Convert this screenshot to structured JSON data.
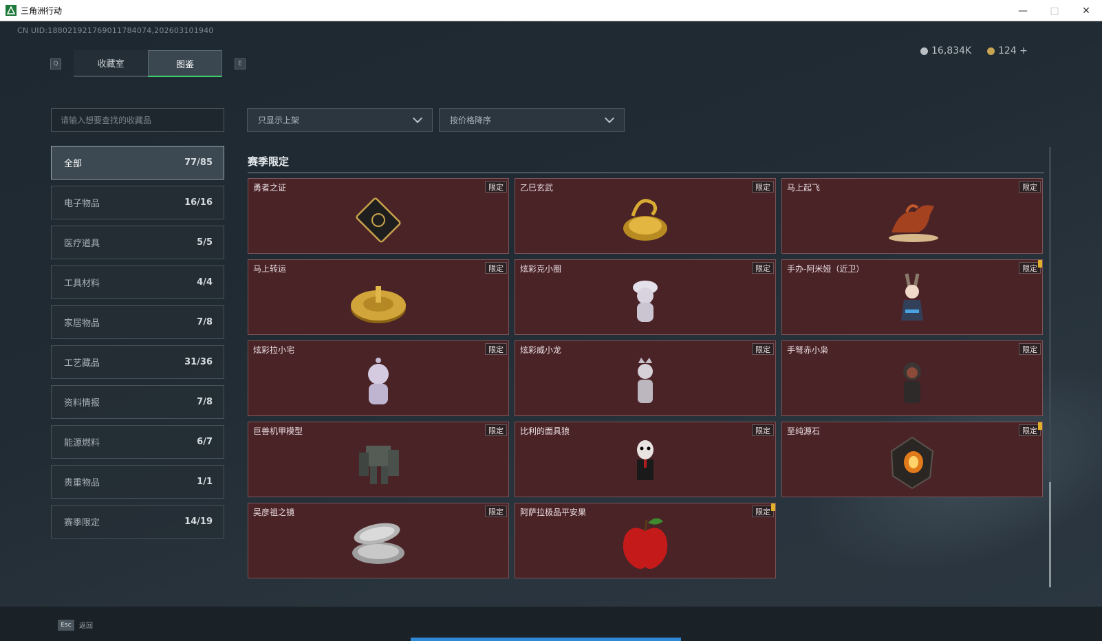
{
  "window": {
    "title": "三角洲行动"
  },
  "uid": "CN UID:18802192176901178407​4,202603101940",
  "tabs": {
    "left_key": "Q",
    "right_key": "E",
    "items": [
      "收藏室",
      "图鉴"
    ],
    "active": 1
  },
  "currency": {
    "coins": "16,834K",
    "gems": "124 +"
  },
  "search": {
    "placeholder": "请输入想要查找的收藏品"
  },
  "categories": [
    {
      "label": "全部",
      "count": "77/85"
    },
    {
      "label": "电子物品",
      "count": "16/16"
    },
    {
      "label": "医疗道具",
      "count": "5/5"
    },
    {
      "label": "工具材料",
      "count": "4/4"
    },
    {
      "label": "家居物品",
      "count": "7/8"
    },
    {
      "label": "工艺藏品",
      "count": "31/36"
    },
    {
      "label": "资料情报",
      "count": "7/8"
    },
    {
      "label": "能源燃料",
      "count": "6/7"
    },
    {
      "label": "贵重物品",
      "count": "1/1"
    },
    {
      "label": "赛季限定",
      "count": "14/19"
    }
  ],
  "filters": {
    "shelf": "只显示上架",
    "sort": "按价格降序"
  },
  "section": {
    "title": "赛季限定"
  },
  "badge_label": "限定",
  "items": [
    {
      "name": "勇者之证",
      "icon": "card-icon",
      "flag": false
    },
    {
      "name": "乙巳玄武",
      "icon": "gold-turtle-icon",
      "flag": false
    },
    {
      "name": "马上起飞",
      "icon": "horse-statue-icon",
      "flag": false
    },
    {
      "name": "马上转运",
      "icon": "gold-disc-icon",
      "flag": false
    },
    {
      "name": "炫彩克小圈",
      "icon": "figurine-icon",
      "flag": false
    },
    {
      "name": "手办-阿米娅（近卫）",
      "icon": "anime-figure-icon",
      "flag": true
    },
    {
      "name": "炫彩拉小宅",
      "icon": "hooded-figurine-icon",
      "flag": false
    },
    {
      "name": "炫彩威小龙",
      "icon": "crowned-figurine-icon",
      "flag": false
    },
    {
      "name": "手弩赤小枭",
      "icon": "hooded-soldier-icon",
      "flag": false
    },
    {
      "name": "巨兽机甲模型",
      "icon": "mech-model-icon",
      "flag": false
    },
    {
      "name": "比利的面具狼",
      "icon": "puppet-icon",
      "flag": false
    },
    {
      "name": "至纯源石",
      "icon": "crystal-icon",
      "flag": true
    },
    {
      "name": "吴彦祖之镜",
      "icon": "compact-mirror-icon",
      "flag": false
    },
    {
      "name": "阿萨拉极品平安果",
      "icon": "apple-icon",
      "flag": true
    }
  ],
  "footer": {
    "key": "Esc",
    "label": "返回"
  },
  "colors": {
    "accent": "#3ecf6c",
    "card_bg": "#4a2327",
    "progress": "#2e88d6"
  }
}
